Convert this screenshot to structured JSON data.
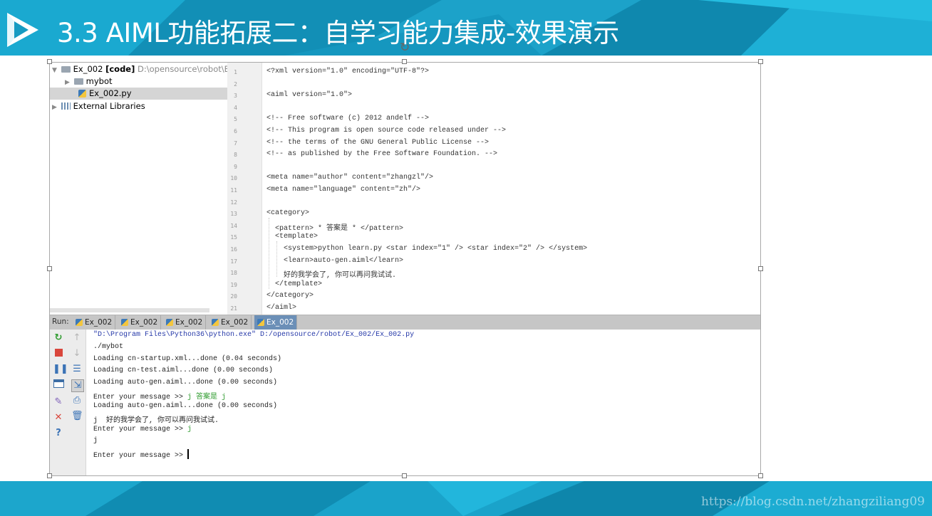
{
  "slide": {
    "title": "3.3 AIML功能拓展二：自学习能力集成-效果演示",
    "watermark": "https://blog.csdn.net/zhangziliang09",
    "band_color": "#169bc2"
  },
  "project_tree": {
    "items": [
      {
        "name": "Ex_002",
        "tag": "[code]",
        "path": "D:\\opensource\\robot\\Ex_",
        "arrow": "▼"
      },
      {
        "name": "mybot",
        "arrow": "▶"
      },
      {
        "name": "Ex_002.py"
      },
      {
        "name": "External Libraries",
        "arrow": "▶"
      }
    ]
  },
  "editor": {
    "lines": [
      {
        "n": "1",
        "text": "<?xml version=\"1.0\" encoding=\"UTF-8\"?>"
      },
      {
        "n": "2",
        "text": ""
      },
      {
        "n": "3",
        "text": "<aiml version=\"1.0\">"
      },
      {
        "n": "4",
        "text": ""
      },
      {
        "n": "5",
        "text": "<!-- Free software (c) 2012 andelf -->"
      },
      {
        "n": "6",
        "text": "<!-- This program is open source code released under -->"
      },
      {
        "n": "7",
        "text": "<!-- the terms of the GNU General Public License -->"
      },
      {
        "n": "8",
        "text": "<!-- as published by the Free Software Foundation. -->"
      },
      {
        "n": "9",
        "text": ""
      },
      {
        "n": "10",
        "text": "<meta name=\"author\" content=\"zhangzl\"/>"
      },
      {
        "n": "11",
        "text": "<meta name=\"language\" content=\"zh\"/>"
      },
      {
        "n": "12",
        "text": ""
      },
      {
        "n": "13",
        "text": "<category>"
      },
      {
        "n": "14",
        "text": "  <pattern> * 答案是 * </pattern>"
      },
      {
        "n": "15",
        "text": "  <template>"
      },
      {
        "n": "16",
        "text": "    <system>python learn.py <star index=\"1\" /> <star index=\"2\" /> </system>"
      },
      {
        "n": "17",
        "text": "    <learn>auto-gen.aiml</learn>"
      },
      {
        "n": "18",
        "text": "    好的我学会了, 你可以再问我试试."
      },
      {
        "n": "19",
        "text": "  </template>"
      },
      {
        "n": "20",
        "text": "</category>"
      },
      {
        "n": "21",
        "text": "</aiml>"
      }
    ]
  },
  "run": {
    "label": "Run:",
    "tabs": [
      "Ex_002",
      "Ex_002",
      "Ex_002",
      "Ex_002",
      "Ex_002"
    ],
    "active_tab_index": 4,
    "console": {
      "command": "\"D:\\Program Files\\Python36\\python.exe\" D:/opensource/robot/Ex_002/Ex_002.py",
      "l1": "./mybot",
      "l2": "Loading cn-startup.xml...done (0.04 seconds)",
      "l3": "Loading cn-test.aiml...done (0.00 seconds)",
      "l4": "Loading auto-gen.aiml...done (0.00 seconds)",
      "prompt": "Enter your message >> ",
      "input1": "j 答案是 j",
      "l6": "Loading auto-gen.aiml...done (0.00 seconds)",
      "l7": "j  好的我学会了, 你可以再问我试试.",
      "input2": "j",
      "l9": "j"
    }
  }
}
